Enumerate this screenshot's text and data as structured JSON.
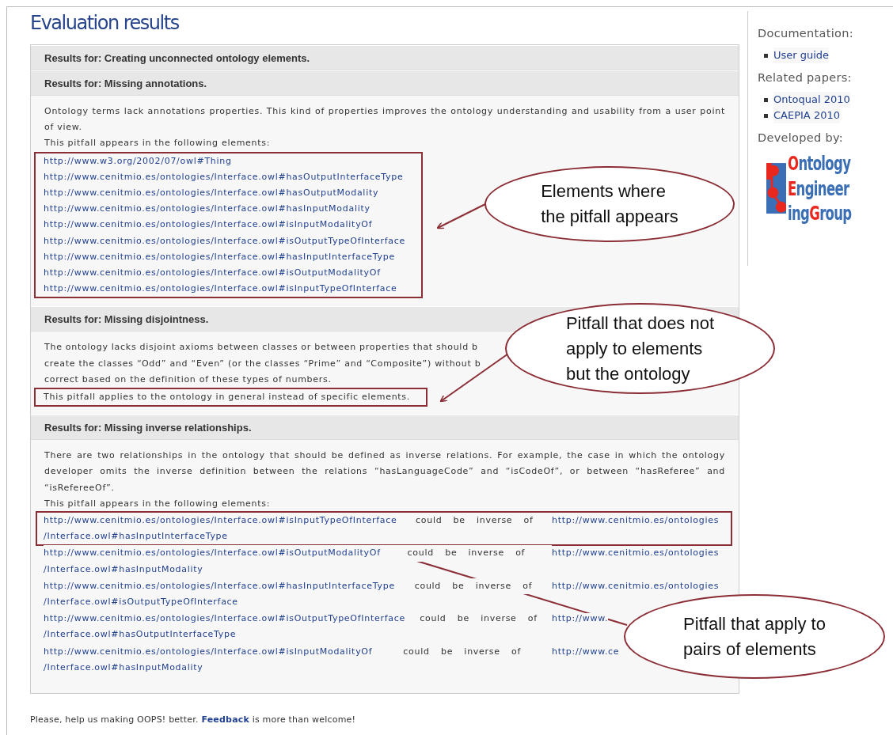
{
  "title": "Evaluation results",
  "sections": [
    {
      "title": "Results for: Creating unconnected ontology elements."
    },
    {
      "title": "Results for: Missing annotations.",
      "paragraphs": [
        "Ontology terms lack annotations properties. This kind of properties improves the ontology understanding and usability from a user point of view."
      ],
      "intro": "This pitfall appears in the following elements:",
      "elements": {
        "boxed": true,
        "items": [
          "http://www.w3.org/2002/07/owl#Thing",
          "http://www.cenitmio.es/ontologies/Interface.owl#hasOutputInterfaceType",
          "http://www.cenitmio.es/ontologies/Interface.owl#hasOutputModality",
          "http://www.cenitmio.es/ontologies/Interface.owl#hasInputModality",
          "http://www.cenitmio.es/ontologies/Interface.owl#isInputModalityOf",
          "http://www.cenitmio.es/ontologies/Interface.owl#isOutputTypeOfInterface",
          "http://www.cenitmio.es/ontologies/Interface.owl#hasInputInterfaceType",
          "http://www.cenitmio.es/ontologies/Interface.owl#isOutputModalityOf",
          "http://www.cenitmio.es/ontologies/Interface.owl#isInputTypeOfInterface"
        ]
      }
    },
    {
      "title": "Results for: Missing disjointness.",
      "lines": [
        "The ontology lacks disjoint axioms between classes or between properties that should b",
        "create the classes “Odd” and “Even” (or the classes “Prime” and “Composite”) without b",
        "correct based on the definition of these types of numbers."
      ],
      "note": {
        "boxed": true,
        "text": "This pitfall applies to the ontology in general instead of specific elements."
      }
    },
    {
      "title": "Results for: Missing inverse relationships.",
      "paragraphs": [
        "There are two relationships in the ontology that should be defined as inverse relations. For example, the case in which the ontology developer omits the inverse definition between the relations “hasLanguageCode” and “isCodeOf”, or between “hasReferee” and “isRefereeOf”."
      ],
      "intro": "This pitfall appears in the following elements:",
      "pairs": [
        {
          "boxed": true,
          "first": "http://www.cenitmio.es/ontologies/Interface.owl#isInputTypeOfInterface",
          "relation": "could be inverse of",
          "second": [
            "http://www.cenitmio.es/ontologies",
            "/Interface.owl#hasInputInterfaceType"
          ]
        },
        {
          "boxed": false,
          "first": "http://www.cenitmio.es/ontologies/Interface.owl#isOutputModalityOf",
          "relation": "could be inverse of",
          "second": [
            "http://www.cenitmio.es/ontologies",
            "/Interface.owl#hasInputModality"
          ]
        },
        {
          "boxed": false,
          "first": "http://www.cenitmio.es/ontologies/Interface.owl#hasInputInterfaceType",
          "relation": "could be inverse of",
          "second": [
            "http://www.cenitmio.es/ontologies",
            "/Interface.owl#isOutputTypeOfInterface"
          ]
        },
        {
          "boxed": false,
          "first": "http://www.cenitmio.es/ontologies/Interface.owl#isOutputTypeOfInterface",
          "relation": "could be inverse of",
          "second": [
            "http://www.",
            "/Interface.owl#hasOutputInterfaceType"
          ]
        },
        {
          "boxed": false,
          "first": "http://www.cenitmio.es/ontologies/Interface.owl#isInputModalityOf",
          "relation": "could be inverse of",
          "second": [
            "http://www.ce",
            "/Interface.owl#hasInputModality"
          ]
        }
      ]
    }
  ],
  "footer": {
    "before": "Please, help us making OOPS! better. ",
    "link": "Feedback",
    "after": " is more than welcome!"
  },
  "sidebar": [
    {
      "heading": "Documentation:",
      "links": [
        "User guide"
      ]
    },
    {
      "heading": "Related papers:",
      "links": [
        "Ontoqual 2010",
        "CAEPIA 2010"
      ]
    },
    {
      "heading": "Developed by:"
    }
  ],
  "logo": {
    "lines": [
      [
        {
          "t": "O",
          "accent": true
        },
        {
          "t": "ntology",
          "accent": false
        }
      ],
      [
        {
          "t": "E",
          "accent": true
        },
        {
          "t": "ngineer",
          "accent": false
        }
      ],
      [
        {
          "t": "ing",
          "accent": false
        },
        {
          "t": "G",
          "accent": true
        },
        {
          "t": "roup",
          "accent": false
        }
      ]
    ]
  },
  "callouts": [
    "Elements where\nthe pitfall appears",
    "Pitfall that does not\napply to elements\nbut the ontology",
    "Pitfall that apply to\npairs of elements"
  ]
}
